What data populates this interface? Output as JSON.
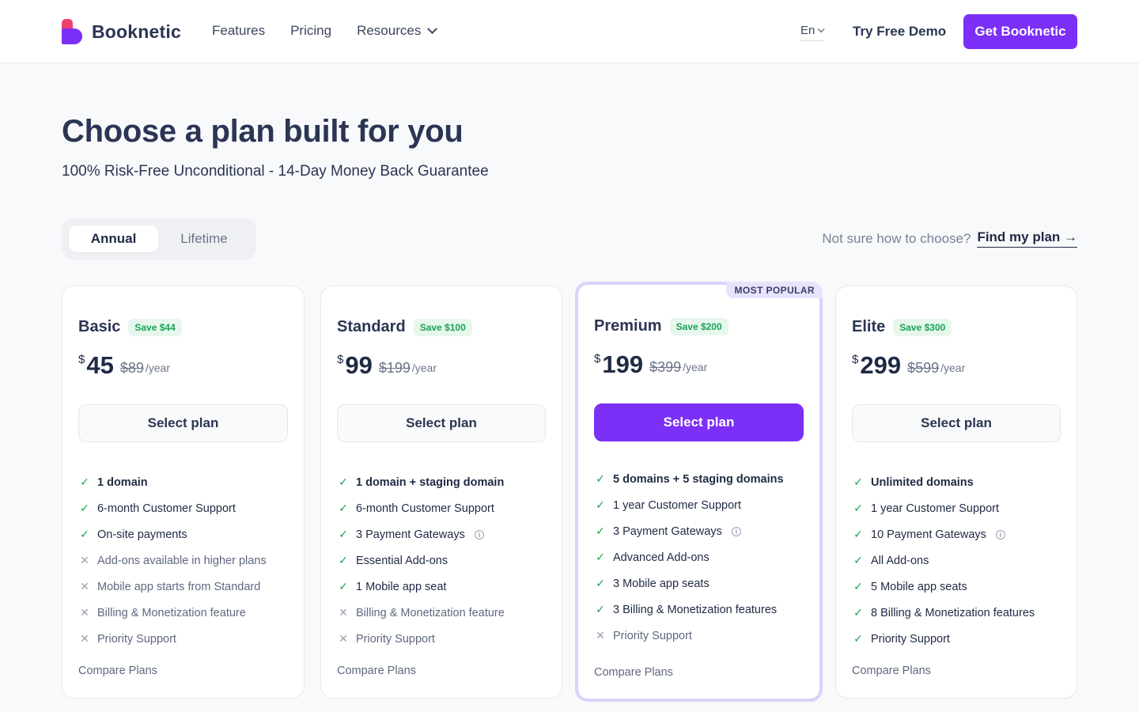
{
  "header": {
    "brand": "Booknetic",
    "nav": [
      {
        "label": "Features"
      },
      {
        "label": "Pricing"
      },
      {
        "label": "Resources"
      }
    ],
    "language": "En",
    "demo_link": "Try Free Demo",
    "cta": "Get Booknetic"
  },
  "hero": {
    "title": "Choose a plan built for you",
    "subtitle": "100% Risk-Free Unconditional - 14-Day Money Back Guarantee"
  },
  "billing_toggle": {
    "options": [
      "Annual",
      "Lifetime"
    ],
    "selected": "Annual"
  },
  "help": {
    "text": "Not sure how to choose?",
    "link": "Find my plan →"
  },
  "colors": {
    "accent": "#7b2ff7",
    "check": "#16a34a",
    "save_text": "#15a553"
  },
  "plans": [
    {
      "name": "Basic",
      "save": "Save $44",
      "currency": "$",
      "price": "45",
      "old_price": "$89",
      "period": "/year",
      "button": "Select plan",
      "features": [
        {
          "text": "1 domain",
          "included": true
        },
        {
          "text": "6-month Customer Support",
          "included": true
        },
        {
          "text": "On-site payments",
          "included": true
        },
        {
          "text": "Add-ons available in higher plans",
          "included": false
        },
        {
          "text": "Mobile app starts from Standard",
          "included": false
        },
        {
          "text": "Billing & Monetization feature",
          "included": false
        },
        {
          "text": "Priority Support",
          "included": false
        }
      ],
      "compare": "Compare Plans"
    },
    {
      "name": "Standard",
      "save": "Save $100",
      "currency": "$",
      "price": "99",
      "old_price": "$199",
      "period": "/year",
      "button": "Select plan",
      "features": [
        {
          "text": "1 domain + staging domain",
          "included": true
        },
        {
          "text": "6-month Customer Support",
          "included": true
        },
        {
          "text": "3 Payment Gateways",
          "included": true,
          "info": true
        },
        {
          "text": "Essential Add-ons",
          "included": true
        },
        {
          "text": "1 Mobile app seat",
          "included": true
        },
        {
          "text": "Billing & Monetization feature",
          "included": false
        },
        {
          "text": "Priority Support",
          "included": false
        }
      ],
      "compare": "Compare Plans"
    },
    {
      "name": "Premium",
      "badge": "MOST POPULAR",
      "save": "Save $200",
      "currency": "$",
      "price": "199",
      "old_price": "$399",
      "period": "/year",
      "button": "Select plan",
      "features": [
        {
          "text": "5 domains + 5 staging domains",
          "included": true
        },
        {
          "text": "1 year Customer Support",
          "included": true
        },
        {
          "text": "3 Payment Gateways",
          "included": true,
          "info": true
        },
        {
          "text": "Advanced Add-ons",
          "included": true
        },
        {
          "text": "3 Mobile app seats",
          "included": true
        },
        {
          "text": "3 Billing & Monetization features",
          "included": true
        },
        {
          "text": "Priority Support",
          "included": false
        }
      ],
      "compare": "Compare Plans"
    },
    {
      "name": "Elite",
      "save": "Save $300",
      "currency": "$",
      "price": "299",
      "old_price": "$599",
      "period": "/year",
      "button": "Select plan",
      "features": [
        {
          "text": "Unlimited domains",
          "included": true
        },
        {
          "text": "1 year Customer Support",
          "included": true
        },
        {
          "text": "10 Payment Gateways",
          "included": true,
          "info": true
        },
        {
          "text": "All Add-ons",
          "included": true
        },
        {
          "text": "5 Mobile app seats",
          "included": true
        },
        {
          "text": "8 Billing & Monetization features",
          "included": true
        },
        {
          "text": "Priority Support",
          "included": true
        }
      ],
      "compare": "Compare Plans"
    }
  ]
}
